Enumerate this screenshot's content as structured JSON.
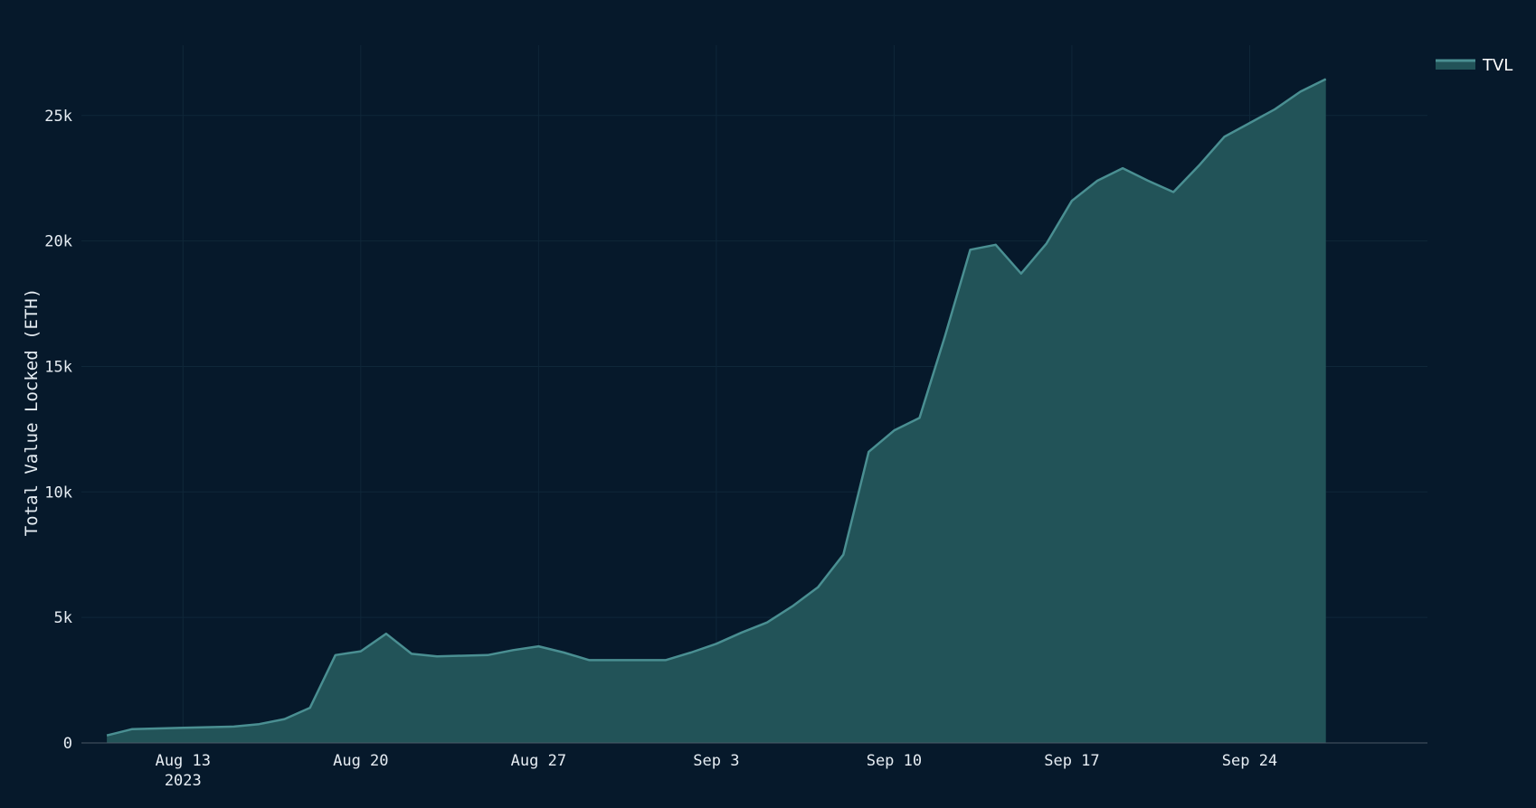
{
  "chart_data": {
    "type": "area",
    "title": "",
    "xlabel": "",
    "ylabel": "Total Value Locked (ETH)",
    "ylim": [
      0,
      27800
    ],
    "xlim": [
      "2023-08-09",
      "2023-10-01"
    ],
    "grid": true,
    "legend_position": "top-right",
    "y_ticks": [
      {
        "value": 0,
        "label": "0"
      },
      {
        "value": 5000,
        "label": "5k"
      },
      {
        "value": 10000,
        "label": "10k"
      },
      {
        "value": 15000,
        "label": "15k"
      },
      {
        "value": 20000,
        "label": "20k"
      },
      {
        "value": 25000,
        "label": "25k"
      }
    ],
    "x_ticks": [
      {
        "date": "2023-08-13",
        "label": "Aug 13",
        "sublabel": "2023"
      },
      {
        "date": "2023-08-20",
        "label": "Aug 20",
        "sublabel": ""
      },
      {
        "date": "2023-08-27",
        "label": "Aug 27",
        "sublabel": ""
      },
      {
        "date": "2023-09-03",
        "label": "Sep 3",
        "sublabel": ""
      },
      {
        "date": "2023-09-10",
        "label": "Sep 10",
        "sublabel": ""
      },
      {
        "date": "2023-09-17",
        "label": "Sep 17",
        "sublabel": ""
      },
      {
        "date": "2023-09-24",
        "label": "Sep 24",
        "sublabel": ""
      }
    ],
    "series": [
      {
        "name": "TVL",
        "color": "#4a8f92",
        "fill": "#225358",
        "x": [
          "2023-08-10",
          "2023-08-11",
          "2023-08-13",
          "2023-08-15",
          "2023-08-16",
          "2023-08-17",
          "2023-08-18",
          "2023-08-19",
          "2023-08-20",
          "2023-08-21",
          "2023-08-22",
          "2023-08-23",
          "2023-08-25",
          "2023-08-26",
          "2023-08-27",
          "2023-08-28",
          "2023-08-29",
          "2023-09-01",
          "2023-09-02",
          "2023-09-03",
          "2023-09-04",
          "2023-09-05",
          "2023-09-06",
          "2023-09-07",
          "2023-09-08",
          "2023-09-09",
          "2023-09-10",
          "2023-09-11",
          "2023-09-12",
          "2023-09-13",
          "2023-09-14",
          "2023-09-15",
          "2023-09-16",
          "2023-09-17",
          "2023-09-18",
          "2023-09-19",
          "2023-09-20",
          "2023-09-21",
          "2023-09-22",
          "2023-09-23",
          "2023-09-24",
          "2023-09-25",
          "2023-09-26",
          "2023-09-27"
        ],
        "values": [
          300,
          550,
          600,
          650,
          750,
          950,
          1400,
          3500,
          3650,
          4350,
          3550,
          3450,
          3500,
          3700,
          3850,
          3600,
          3300,
          3300,
          3600,
          3950,
          4400,
          4800,
          5450,
          6200,
          7500,
          11600,
          12450,
          12950,
          16200,
          19650,
          19850,
          18700,
          19900,
          21600,
          22400,
          22900,
          22400,
          21950,
          23000,
          24150,
          24700,
          25250,
          25950,
          26450
        ]
      }
    ]
  }
}
